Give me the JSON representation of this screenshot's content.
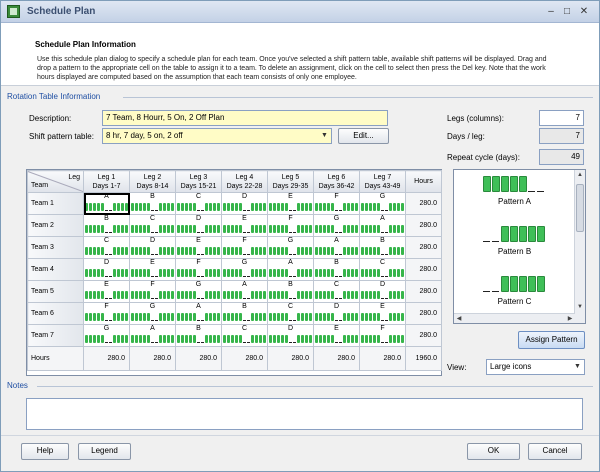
{
  "window": {
    "title": "Schedule Plan"
  },
  "header": {
    "title": "Schedule Plan Information",
    "description": "Use this schedule plan dialog to specify a schedule plan for each team. Once you've selected a shift pattern table, available shift patterns will be displayed. Drag and drop a pattern to the appropriate cell on the table to assign it to a team. To delete an assignment, click on the cell to select then press the Del key. Note that the work hours displayed are computed based on the assumption that each team consists of only one employee."
  },
  "rotation": {
    "section_label": "Rotation Table Information",
    "description_label": "Description:",
    "description_value": "7 Team, 8 Hourr, 5 On, 2 Off  Plan",
    "shift_pattern_label": "Shift pattern table:",
    "shift_pattern_value": "8 hr, 7 day, 5 on, 2 off",
    "edit_button": "Edit...",
    "legs_label": "Legs (columns):",
    "legs_value": "7",
    "days_per_leg_label": "Days / leg:",
    "days_per_leg_value": "7",
    "repeat_cycle_label": "Repeat cycle (days):",
    "repeat_cycle_value": "49"
  },
  "table": {
    "corner_leg": "Leg",
    "corner_team": "Team",
    "hours_header": "Hours",
    "legs": [
      {
        "name": "Leg 1",
        "days": "Days 1-7"
      },
      {
        "name": "Leg 2",
        "days": "Days 8-14"
      },
      {
        "name": "Leg 3",
        "days": "Days 15-21"
      },
      {
        "name": "Leg 4",
        "days": "Days 22-28"
      },
      {
        "name": "Leg 5",
        "days": "Days 29-35"
      },
      {
        "name": "Leg 6",
        "days": "Days 36-42"
      },
      {
        "name": "Leg 7",
        "days": "Days 43-49"
      }
    ],
    "teams": [
      {
        "name": "Team 1",
        "cells": [
          "A",
          "B",
          "C",
          "D",
          "E",
          "F",
          "G"
        ],
        "hours": "280.0"
      },
      {
        "name": "Team 2",
        "cells": [
          "B",
          "C",
          "D",
          "E",
          "F",
          "G",
          "A"
        ],
        "hours": "280.0"
      },
      {
        "name": "Team 3",
        "cells": [
          "C",
          "D",
          "E",
          "F",
          "G",
          "A",
          "B"
        ],
        "hours": "280.0"
      },
      {
        "name": "Team 4",
        "cells": [
          "D",
          "E",
          "F",
          "G",
          "A",
          "B",
          "C"
        ],
        "hours": "280.0"
      },
      {
        "name": "Team 5",
        "cells": [
          "E",
          "F",
          "G",
          "A",
          "B",
          "C",
          "D"
        ],
        "hours": "280.0"
      },
      {
        "name": "Team 6",
        "cells": [
          "F",
          "G",
          "A",
          "B",
          "C",
          "D",
          "E"
        ],
        "hours": "280.0"
      },
      {
        "name": "Team 7",
        "cells": [
          "G",
          "A",
          "B",
          "C",
          "D",
          "E",
          "F"
        ],
        "hours": "280.0"
      }
    ],
    "totals_label": "Hours",
    "totals": [
      "280.0",
      "280.0",
      "280.0",
      "280.0",
      "280.0",
      "280.0",
      "280.0"
    ],
    "grand_total": "1960.0"
  },
  "patterns": [
    {
      "name": "Pattern A",
      "days": [
        "on",
        "on",
        "on",
        "on",
        "on",
        "off",
        "off"
      ]
    },
    {
      "name": "Pattern B",
      "days": [
        "off",
        "off",
        "on",
        "on",
        "on",
        "on",
        "on"
      ]
    },
    {
      "name": "Pattern C",
      "days": [
        "off",
        "off",
        "on",
        "on",
        "on",
        "on",
        "on"
      ]
    }
  ],
  "patterns_panel": {
    "assign_button": "Assign Pattern",
    "view_label": "View:",
    "view_value": "Large icons"
  },
  "notes": {
    "section_label": "Notes",
    "value": ""
  },
  "footer": {
    "help": "Help",
    "legend": "Legend",
    "ok": "OK",
    "cancel": "Cancel"
  }
}
